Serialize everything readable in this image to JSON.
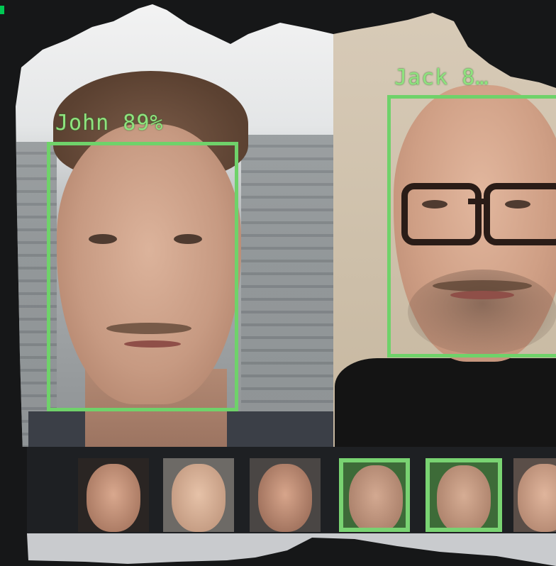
{
  "colors": {
    "detection_box": "#6fd26a",
    "label_text": "#8ee37e",
    "page_background": "#161718",
    "selected_thumbnail": "#79d372",
    "indicator": "#00c853"
  },
  "detections": [
    {
      "label": "John 89%"
    },
    {
      "label": "Jack 8…"
    }
  ],
  "thumbnails": [
    {
      "selected": false
    },
    {
      "selected": false
    },
    {
      "selected": false
    },
    {
      "selected": true
    },
    {
      "selected": true
    },
    {
      "selected": false
    }
  ]
}
